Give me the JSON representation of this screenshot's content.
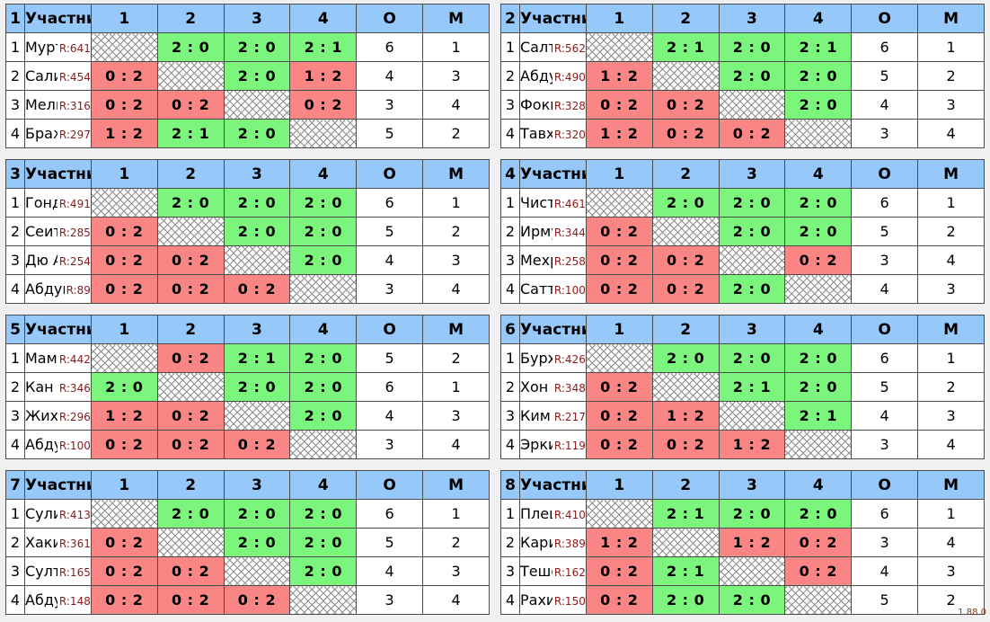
{
  "version_label": "1.88.0",
  "columns": {
    "participant": "Участник",
    "opponents": [
      "1",
      "2",
      "3",
      "4"
    ],
    "points": "О",
    "place": "М"
  },
  "colors": {
    "header_bg": "#96c8fa",
    "group_badge_bg": "#6a6a9e",
    "win_bg": "#7bf57b",
    "loss_bg": "#fa8585",
    "rating_text": "#8b1a1a"
  },
  "groups": [
    {
      "number": "1",
      "rows": [
        {
          "idx": "1",
          "name": "Муртаза М",
          "rating": "R:641",
          "scores": [
            "",
            "2 : 0",
            "2 : 0",
            "2 : 1"
          ],
          "results": [
            "self",
            "win",
            "win",
            "win"
          ],
          "points": "6",
          "place": "1"
        },
        {
          "idx": "2",
          "name": "Салихов А",
          "rating": "R:454",
          "scores": [
            "0 : 2",
            "",
            "2 : 0",
            "1 : 2"
          ],
          "results": [
            "loss",
            "self",
            "win",
            "loss"
          ],
          "points": "4",
          "place": "3"
        },
        {
          "idx": "3",
          "name": "Мельников В",
          "rating": "R:316",
          "scores": [
            "0 : 2",
            "0 : 2",
            "",
            "0 : 2"
          ],
          "results": [
            "loss",
            "loss",
            "self",
            "loss"
          ],
          "points": "3",
          "place": "4"
        },
        {
          "idx": "4",
          "name": "Бражников В",
          "rating": "R:297",
          "scores": [
            "1 : 2",
            "2 : 1",
            "2 : 0",
            ""
          ],
          "results": [
            "loss",
            "win",
            "win",
            "self"
          ],
          "points": "5",
          "place": "2"
        }
      ]
    },
    {
      "number": "2",
      "rows": [
        {
          "idx": "1",
          "name": "Салтыков В",
          "rating": "R:562",
          "scores": [
            "",
            "2 : 1",
            "2 : 0",
            "2 : 1"
          ],
          "results": [
            "self",
            "win",
            "win",
            "win"
          ],
          "points": "6",
          "place": "1"
        },
        {
          "idx": "2",
          "name": "Абдувахидов Ш",
          "rating": "R:490",
          "scores": [
            "1 : 2",
            "",
            "2 : 0",
            "2 : 0"
          ],
          "results": [
            "loss",
            "self",
            "win",
            "win"
          ],
          "points": "5",
          "place": "2"
        },
        {
          "idx": "3",
          "name": "Фокин И",
          "rating": "R:328",
          "scores": [
            "0 : 2",
            "0 : 2",
            "",
            "2 : 0"
          ],
          "results": [
            "loss",
            "loss",
            "self",
            "win"
          ],
          "points": "4",
          "place": "3"
        },
        {
          "idx": "4",
          "name": "Тавхидов Р",
          "rating": "R:320",
          "scores": [
            "1 : 2",
            "0 : 2",
            "0 : 2",
            ""
          ],
          "results": [
            "loss",
            "loss",
            "loss",
            "self"
          ],
          "points": "3",
          "place": "4"
        }
      ]
    },
    {
      "number": "3",
      "rows": [
        {
          "idx": "1",
          "name": "Гондаренко В",
          "rating": "R:491",
          "scores": [
            "",
            "2 : 0",
            "2 : 0",
            "2 : 0"
          ],
          "results": [
            "self",
            "win",
            "win",
            "win"
          ],
          "points": "6",
          "place": "1"
        },
        {
          "idx": "2",
          "name": "Сеитвили Х",
          "rating": "R:285",
          "scores": [
            "0 : 2",
            "",
            "2 : 0",
            "2 : 0"
          ],
          "results": [
            "loss",
            "self",
            "win",
            "win"
          ],
          "points": "5",
          "place": "2"
        },
        {
          "idx": "3",
          "name": "Дю А",
          "rating": "R:254",
          "scores": [
            "0 : 2",
            "0 : 2",
            "",
            "2 : 0"
          ],
          "results": [
            "loss",
            "loss",
            "self",
            "win"
          ],
          "points": "4",
          "place": "3"
        },
        {
          "idx": "4",
          "name": "Абдукаримов Э",
          "rating": "R:89",
          "scores": [
            "0 : 2",
            "0 : 2",
            "0 : 2",
            ""
          ],
          "results": [
            "loss",
            "loss",
            "loss",
            "self"
          ],
          "points": "3",
          "place": "4"
        }
      ]
    },
    {
      "number": "4",
      "rows": [
        {
          "idx": "1",
          "name": "Чистяков А",
          "rating": "R:461",
          "scores": [
            "",
            "2 : 0",
            "2 : 0",
            "2 : 0"
          ],
          "results": [
            "self",
            "win",
            "win",
            "win"
          ],
          "points": "6",
          "place": "1"
        },
        {
          "idx": "2",
          "name": "Ирмухамедов А",
          "rating": "R:344",
          "scores": [
            "0 : 2",
            "",
            "2 : 0",
            "2 : 0"
          ],
          "results": [
            "loss",
            "self",
            "win",
            "win"
          ],
          "points": "5",
          "place": "2"
        },
        {
          "idx": "3",
          "name": "Мехриддинов Д",
          "rating": "R:258",
          "scores": [
            "0 : 2",
            "0 : 2",
            "",
            "0 : 2"
          ],
          "results": [
            "loss",
            "loss",
            "self",
            "loss"
          ],
          "points": "3",
          "place": "4"
        },
        {
          "idx": "4",
          "name": "Сатторов Н",
          "rating": "R:100",
          "scores": [
            "0 : 2",
            "0 : 2",
            "2 : 0",
            ""
          ],
          "results": [
            "loss",
            "loss",
            "win",
            "self"
          ],
          "points": "4",
          "place": "3"
        }
      ]
    },
    {
      "number": "5",
      "rows": [
        {
          "idx": "1",
          "name": "Мамасадыков А",
          "rating": "R:442",
          "scores": [
            "",
            "0 : 2",
            "2 : 1",
            "2 : 0"
          ],
          "results": [
            "self",
            "loss",
            "win",
            "win"
          ],
          "points": "5",
          "place": "2"
        },
        {
          "idx": "2",
          "name": "Кан А",
          "rating": "R:346",
          "scores": [
            "2 : 0",
            "",
            "2 : 0",
            "2 : 0"
          ],
          "results": [
            "win",
            "self",
            "win",
            "win"
          ],
          "points": "6",
          "place": "1"
        },
        {
          "idx": "3",
          "name": "Жихарцев А",
          "rating": "R:296",
          "scores": [
            "1 : 2",
            "0 : 2",
            "",
            "2 : 0"
          ],
          "results": [
            "loss",
            "loss",
            "self",
            "win"
          ],
          "points": "4",
          "place": "3"
        },
        {
          "idx": "4",
          "name": "Абдуллаев Ш",
          "rating": "R:100",
          "scores": [
            "0 : 2",
            "0 : 2",
            "0 : 2",
            ""
          ],
          "results": [
            "loss",
            "loss",
            "loss",
            "self"
          ],
          "points": "3",
          "place": "4"
        }
      ]
    },
    {
      "number": "6",
      "rows": [
        {
          "idx": "1",
          "name": "Бурханов Т",
          "rating": "R:426",
          "scores": [
            "",
            "2 : 0",
            "2 : 0",
            "2 : 0"
          ],
          "results": [
            "self",
            "win",
            "win",
            "win"
          ],
          "points": "6",
          "place": "1"
        },
        {
          "idx": "2",
          "name": "Хон В",
          "rating": "R:348",
          "scores": [
            "0 : 2",
            "",
            "2 : 1",
            "2 : 0"
          ],
          "results": [
            "loss",
            "self",
            "win",
            "win"
          ],
          "points": "5",
          "place": "2"
        },
        {
          "idx": "3",
          "name": "Ким В",
          "rating": "R:217",
          "scores": [
            "0 : 2",
            "1 : 2",
            "",
            "2 : 1"
          ],
          "results": [
            "loss",
            "loss",
            "self",
            "win"
          ],
          "points": "4",
          "place": "3"
        },
        {
          "idx": "4",
          "name": "Эркинов С",
          "rating": "R:119",
          "scores": [
            "0 : 2",
            "0 : 2",
            "1 : 2",
            ""
          ],
          "results": [
            "loss",
            "loss",
            "loss",
            "self"
          ],
          "points": "3",
          "place": "4"
        }
      ]
    },
    {
      "number": "7",
      "rows": [
        {
          "idx": "1",
          "name": "Сулин Т",
          "rating": "R:413",
          "scores": [
            "",
            "2 : 0",
            "2 : 0",
            "2 : 0"
          ],
          "results": [
            "self",
            "win",
            "win",
            "win"
          ],
          "points": "6",
          "place": "1"
        },
        {
          "idx": "2",
          "name": "Хакимов Т",
          "rating": "R:361",
          "scores": [
            "0 : 2",
            "",
            "2 : 0",
            "2 : 0"
          ],
          "results": [
            "loss",
            "self",
            "win",
            "win"
          ],
          "points": "5",
          "place": "2"
        },
        {
          "idx": "3",
          "name": "Султанбеков Ф",
          "rating": "R:165",
          "scores": [
            "0 : 2",
            "0 : 2",
            "",
            "2 : 0"
          ],
          "results": [
            "loss",
            "loss",
            "self",
            "win"
          ],
          "points": "4",
          "place": "3"
        },
        {
          "idx": "4",
          "name": "Абдуллаев Т",
          "rating": "R:148",
          "scores": [
            "0 : 2",
            "0 : 2",
            "0 : 2",
            ""
          ],
          "results": [
            "loss",
            "loss",
            "loss",
            "self"
          ],
          "points": "3",
          "place": "4"
        }
      ]
    },
    {
      "number": "8",
      "rows": [
        {
          "idx": "1",
          "name": "Плещаков И",
          "rating": "R:410",
          "scores": [
            "",
            "2 : 1",
            "2 : 0",
            "2 : 0"
          ],
          "results": [
            "self",
            "win",
            "win",
            "win"
          ],
          "points": "6",
          "place": "1"
        },
        {
          "idx": "2",
          "name": "Каримов Ш",
          "rating": "R:389",
          "scores": [
            "1 : 2",
            "",
            "1 : 2",
            "0 : 2"
          ],
          "results": [
            "loss",
            "self",
            "loss",
            "loss"
          ],
          "points": "3",
          "place": "4"
        },
        {
          "idx": "3",
          "name": "Тешебаева Т",
          "rating": "R:162",
          "scores": [
            "0 : 2",
            "2 : 1",
            "",
            "0 : 2"
          ],
          "results": [
            "loss",
            "win",
            "self",
            "loss"
          ],
          "points": "4",
          "place": "3"
        },
        {
          "idx": "4",
          "name": "Рахимов Б",
          "rating": "R:150",
          "scores": [
            "0 : 2",
            "2 : 0",
            "2 : 0",
            ""
          ],
          "results": [
            "loss",
            "win",
            "win",
            "self"
          ],
          "points": "5",
          "place": "2"
        }
      ]
    }
  ]
}
